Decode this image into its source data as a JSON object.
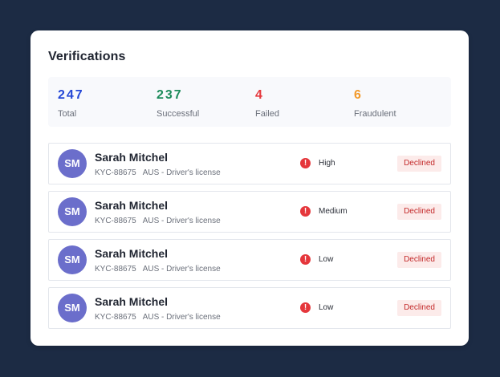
{
  "card": {
    "title": "Verifications"
  },
  "stats": [
    {
      "value": "247",
      "label": "Total",
      "color": "#2447d6"
    },
    {
      "value": "237",
      "label": "Successful",
      "color": "#1e8c5c"
    },
    {
      "value": "4",
      "label": "Failed",
      "color": "#e5373c"
    },
    {
      "value": "6",
      "label": "Fraudulent",
      "color": "#f29a2b"
    }
  ],
  "verifications": [
    {
      "initials": "SM",
      "name": "Sarah Mitchel",
      "id": "KYC-88675",
      "document": "AUS - Driver's license",
      "risk_icon": "!",
      "risk": "High",
      "status": "Declined"
    },
    {
      "initials": "SM",
      "name": "Sarah Mitchel",
      "id": "KYC-88675",
      "document": "AUS - Driver's license",
      "risk_icon": "!",
      "risk": "Medium",
      "status": "Declined"
    },
    {
      "initials": "SM",
      "name": "Sarah Mitchel",
      "id": "KYC-88675",
      "document": "AUS - Driver's license",
      "risk_icon": "!",
      "risk": "Low",
      "status": "Declined"
    },
    {
      "initials": "SM",
      "name": "Sarah Mitchel",
      "id": "KYC-88675",
      "document": "AUS - Driver's license",
      "risk_icon": "!",
      "risk": "Low",
      "status": "Declined"
    }
  ],
  "icons": {
    "risk": "alert-circle-icon"
  },
  "colors": {
    "background": "#1c2b44",
    "avatar": "#6b6ecb",
    "badge_bg": "#fcebea",
    "badge_text": "#c3292a",
    "alert": "#e5373c"
  }
}
